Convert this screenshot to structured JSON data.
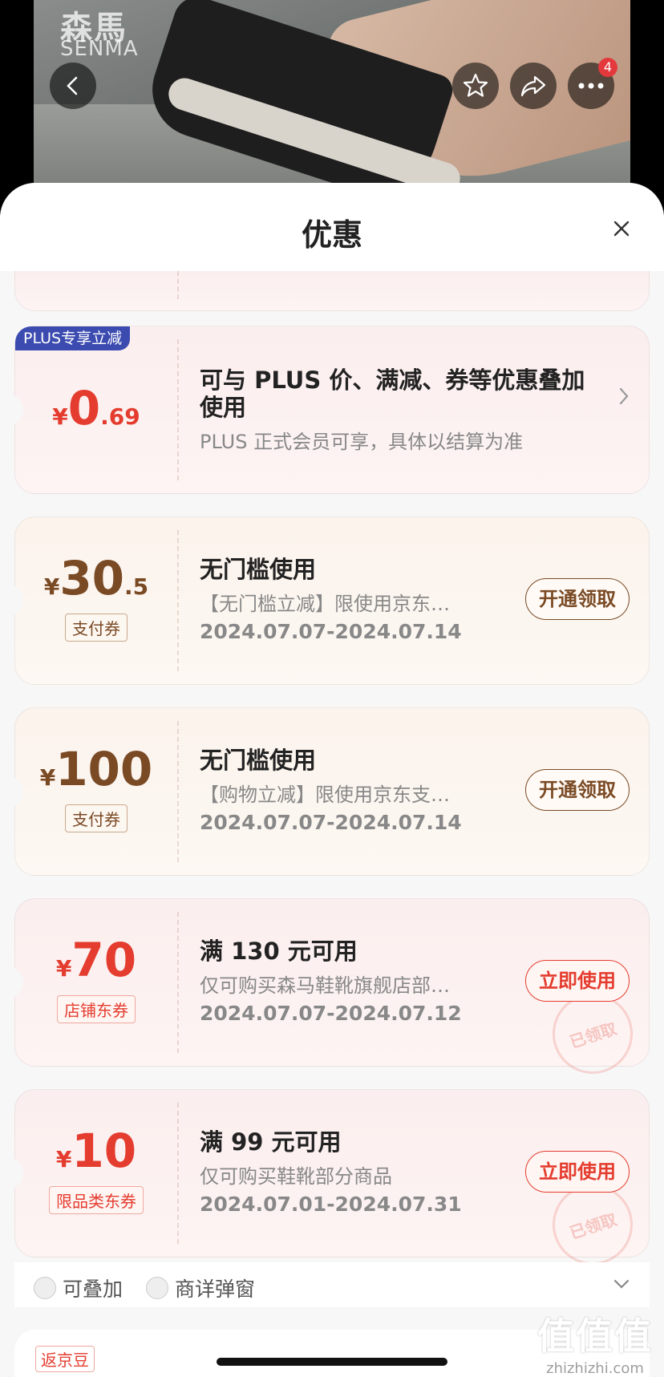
{
  "hero": {
    "brand_cn": "森馬",
    "brand_en": "SENMA",
    "more_badge": "4"
  },
  "sheet": {
    "title": "优惠"
  },
  "plus_card": {
    "tag": "PLUS专享立减",
    "currency": "¥",
    "amount_int": "0",
    "amount_dec": ".69",
    "title_line1": "可与 PLUS 价、满减、券等优惠叠加",
    "title_line2": "使用",
    "sub": "PLUS 正式会员可享，具体以结算为准"
  },
  "coupons": [
    {
      "currency": "¥",
      "amount_int": "30",
      "amount_dec": ".5",
      "type_tag": "支付券",
      "title": "无门槛使用",
      "sub": "【无门槛立减】限使用京东…",
      "date": "2024.07.07-2024.07.14",
      "button": "开通领取"
    },
    {
      "currency": "¥",
      "amount_int": "100",
      "amount_dec": "",
      "type_tag": "支付券",
      "title": "无门槛使用",
      "sub": "【购物立减】限使用京东支…",
      "date": "2024.07.07-2024.07.14",
      "button": "开通领取"
    },
    {
      "currency": "¥",
      "amount_int": "70",
      "amount_dec": "",
      "type_tag": "店铺东券",
      "title": "满 130 元可用",
      "sub": "仅可购买森马鞋靴旗舰店部…",
      "date": "2024.07.07-2024.07.12",
      "button": "立即使用",
      "stamp": "已领取"
    },
    {
      "currency": "¥",
      "amount_int": "10",
      "amount_dec": "",
      "type_tag": "限品类东券",
      "title": "满 99 元可用",
      "sub": "仅可购买鞋靴部分商品",
      "date": "2024.07.01-2024.07.31",
      "button": "立即使用",
      "stamp": "已领取"
    }
  ],
  "footer": {
    "stackable": "可叠加",
    "popup": "商详弹窗"
  },
  "next_card": {
    "tag": "返京豆"
  },
  "watermark": {
    "logo": "值值值",
    "text": "zhizhizhi.com"
  }
}
